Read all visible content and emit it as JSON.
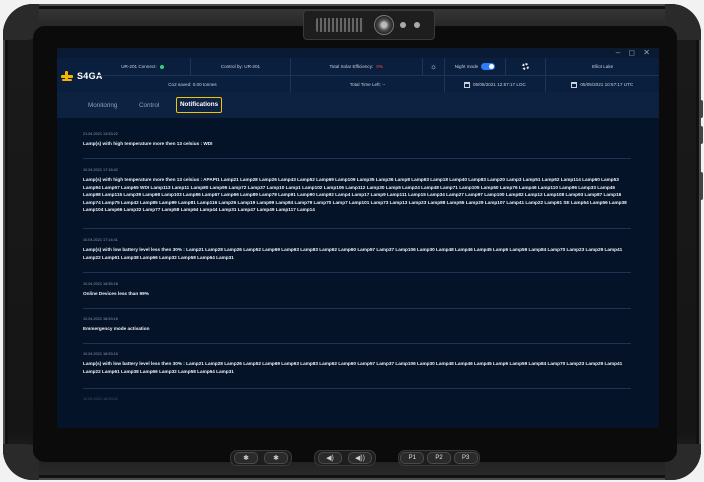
{
  "app": {
    "logo_text": "S4GA"
  },
  "window_controls": "– ◻ ✕",
  "header": {
    "ur_connect": "UR-201 Connect:",
    "control_by": "Control by: UR-201",
    "solar_label": "Total Solar Efficiency:",
    "solar_value": "0%",
    "night_mode": "Night mode",
    "user": "Elliot Lake",
    "co2": "Co2 saved: 0.00 tonnes",
    "time_left": "Total Time Left: --",
    "loc_time": "05/05/2021 12:57:17 LOC",
    "utc_time": "05/05/2021 10:57:17 UTC"
  },
  "nav": {
    "tabs": [
      {
        "label": "Monitoring"
      },
      {
        "label": "Control"
      },
      {
        "label": "Notifications"
      }
    ],
    "active": "Notifications"
  },
  "notifications": [
    {
      "date": "21.04.2021 13:53:22",
      "text": "Lamp(s) with high temperature more then 13 celsius : WDI"
    },
    {
      "date": "10.04.2021 17:16:42",
      "text": "Lamp(s) with high temperature more then 13 celsius : APAPI1 Lamp21 Lamp28 Lamp26 Lamp43 Lamp52 Lamp69 Lamp109 Lamp35 Lamp36 Lamp8 Lamp63 Lamp18 Lamp40 Lamp83 Lamp20 Lamp3 Lamp51 Lamp62 Lamp114 Lamp60 Lamp53 Lamp94 Lamp57 Lamp65 WDI Lamp113 Lamp11 Lamp80 Lamp95 Lamp72 Lamp37 Lamp10 Lamp1 Lamp102 Lamp106 Lamp112 Lamp30 Lamp5 Lamp24 Lamp48 Lamp71 Lamp105 Lamp50 Lamp76 Lamp46 Lamp110 Lamp96 Lamp33 Lamp45 Lamp98 Lamp115 Lamp39 Lamp68 Lamp103 Lamp86 Lamp67 Lamp66 Lamp89 Lamp78 Lamp91 Lamp90 Lamp92 Lamp4 Lamp17 Lamp9 Lamp111 Lamp15 Lamp34 Lamp27 Lamp97 Lamp100 Lamp82 Lamp12 Lamp108 Lamp93 Lamp87 Lamp16 Lamp74 Lamp75 Lamp42 Lamp85 Lamp99 Lamp81 Lamp116 Lamp25 Lamp19 Lamp99 Lamp84 Lamp79 Lamp70 Lamp7 Lamp101 Lamp73 Lamp13 Lamp23 Lamp88 Lamp55 Lamp29 Lamp107 Lamp41 Lamp22 Lamp61 SE Lamp54 Lamp56 Lamp38 Lamp104 Lamp66 Lamp32 Lamp77 Lamp58 Lamp64 Lamp44 Lamp31 Lamp47 Lamp49 Lamp117 Lamp14"
    },
    {
      "date": "10.04.2021 17:14:41",
      "text": "Lamp(s) with low battery level less then 30% : Lamp21 Lamp28 Lamp26 Lamp52 Lamp69 Lamp63 Lamp83 Lamp62 Lamp60 Lamp57 Lamp37 Lamp106 Lamp30 Lamp48 Lamp46 Lamp45 Lamp6 Lamp59 Lamp84 Lamp70 Lamp23 Lamp29 Lamp41 Lamp22 Lamp61 Lamp38 Lamp66 Lamp32 Lamp58 Lamp64 Lamp31"
    },
    {
      "date": "10.04.2021 18:55:18",
      "text": "Online Devices less than 99%"
    },
    {
      "date": "10.04.2021 18:53:16",
      "text": "Emmergency mode activation"
    },
    {
      "date": "10.04.2021 18:53:15",
      "text": "Lamp(s) with low battery level less then 30% : Lamp21 Lamp28 Lamp26 Lamp52 Lamp69 Lamp63 Lamp83 Lamp62 Lamp60 Lamp57 Lamp37 Lamp106 Lamp30 Lamp48 Lamp46 Lamp45 Lamp6 Lamp59 Lamp84 Lamp70 Lamp23 Lamp29 Lamp41 Lamp22 Lamp61 Lamp38 Lamp66 Lamp32 Lamp58 Lamp64 Lamp31"
    },
    {
      "date": "10.04.2021 18:53:02",
      "text": ""
    }
  ],
  "hardware": {
    "buttons": [
      "P1",
      "P2",
      "P3"
    ],
    "brightness_down": "✱",
    "brightness_up": "✱",
    "vol_down": "◀)",
    "vol_up": "◀))"
  },
  "colors": {
    "screen_bg": "#051329",
    "accent_yellow": "#f5c400",
    "status_green": "#2ed47a",
    "alert_red": "#ff4d4d",
    "toggle_blue": "#2f7cf6"
  }
}
